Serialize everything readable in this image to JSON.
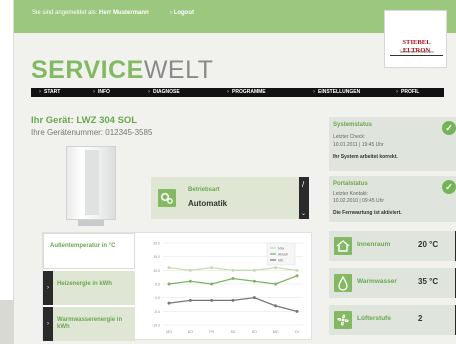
{
  "topbar": {
    "login_prefix": "Sie sind angemeldet als:",
    "user": "Herr Mustermann",
    "logout": "› Logout"
  },
  "logo": {
    "name": "STIEBEL ELTRON",
    "tagline": "Technik zum Wohlfühlen"
  },
  "brand": {
    "part1": "SERVICE",
    "part2": "WELT"
  },
  "nav": [
    "START",
    "INFO",
    "DIAGNOSE",
    "PROGRAMME",
    "EINSTELLUNGEN",
    "PROFIL"
  ],
  "device": {
    "title": "Ihr Gerät: LWZ 304 SOL",
    "number": "Ihre Gerätenummer: 012345-3585"
  },
  "betriebsart": {
    "label": "Betriebsart",
    "value": "Automatik"
  },
  "systemstatus": {
    "title": "Systemstatus",
    "check_label": "Letzter Check:",
    "check_date": "10.01.2011 | 19:45 Uhr",
    "message": "Ihr System arbeitet korrekt."
  },
  "portalstatus": {
    "title": "Portalstatus",
    "contact_label": "Letzter Kontakt:",
    "contact_date": "10.02.2010 | 09:45 Uhr",
    "message": "Die Fernwartung ist aktiviert."
  },
  "chart_tabs": {
    "outside_temp": "Außentemperatur in °C",
    "heating_energy": "Heizenergie in kWh",
    "water_energy": "Warmwasserenergie in kWh"
  },
  "side_cards": [
    {
      "label": "Innenraum",
      "value": "20 °C",
      "icon": "house-icon"
    },
    {
      "label": "Warmwasser",
      "value": "35 °C",
      "icon": "water-icon"
    },
    {
      "label": "Lüfterstufe",
      "value": "2",
      "icon": "fan-icon"
    }
  ],
  "colors": {
    "accent": "#84b964",
    "dark": "#111111",
    "card": "#dfe4dc"
  },
  "chart_data": {
    "type": "line",
    "categories": [
      "MO",
      "DO",
      "FR",
      "SA",
      "SO",
      "MO",
      "DI"
    ],
    "ylim": [
      -10,
      20
    ],
    "yticks": [
      "20.0",
      "15.0",
      "10.0",
      "5.0",
      "0.0",
      "-5.0",
      "-10.0"
    ],
    "legend": [
      "Max",
      "Aktuell",
      "Min"
    ],
    "series": [
      {
        "name": "Max",
        "values": [
          11,
          10,
          11,
          10,
          10,
          11,
          10
        ],
        "color": "#c5dcb3"
      },
      {
        "name": "Aktuell",
        "values": [
          5,
          6,
          5,
          7,
          6,
          5,
          8
        ],
        "color": "#7fb361"
      },
      {
        "name": "Min",
        "values": [
          -2,
          -1,
          -1,
          -1,
          0,
          -3,
          -5
        ],
        "color": "#777777"
      }
    ]
  }
}
